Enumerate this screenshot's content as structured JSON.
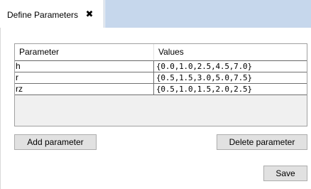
{
  "tab": {
    "title": "Define Parameters",
    "close_glyph": "✖"
  },
  "table": {
    "headers": [
      "Parameter",
      "Values"
    ],
    "rows": [
      {
        "parameter": "h",
        "values": "{0.0,1.0,2.5,4.5,7.0}"
      },
      {
        "parameter": "r",
        "values": "{0.5,1.5,3.0,5.0,7.5}"
      },
      {
        "parameter": "rz",
        "values": "{0.5,1.0,1.5,2.0,2.5}"
      }
    ]
  },
  "buttons": {
    "add": "Add parameter",
    "delete": "Delete parameter",
    "save": "Save"
  },
  "colors": {
    "tab_strip_bg": "#c6d7ec",
    "button_bg": "#e1e1e1",
    "table_empty_bg": "#f0f0f0"
  }
}
